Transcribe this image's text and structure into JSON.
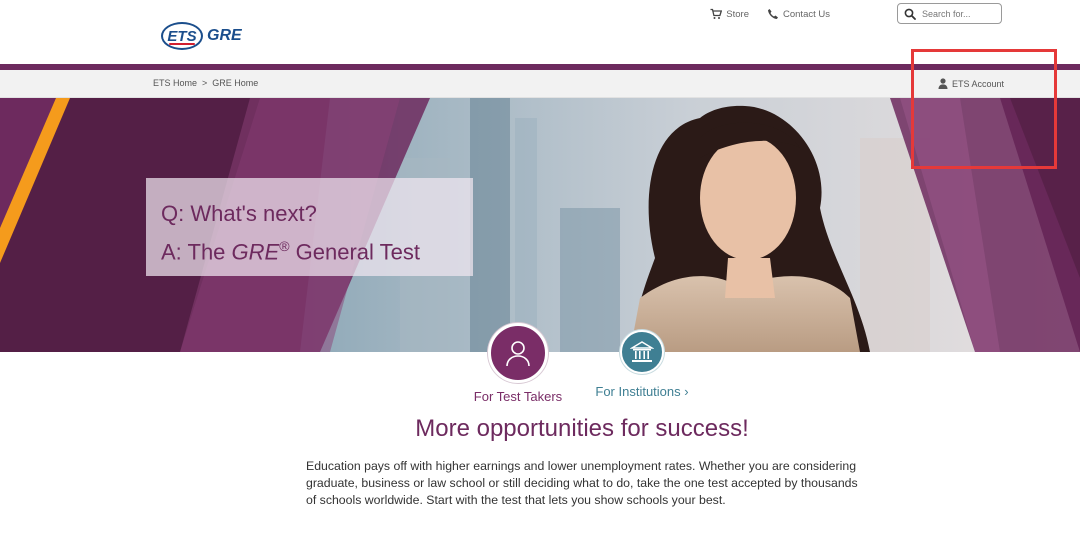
{
  "header": {
    "logo": {
      "ets": "ETS",
      "gre": "GRE"
    },
    "links": {
      "store": "Store",
      "contact": "Contact Us"
    },
    "search": {
      "placeholder": "Search for..."
    }
  },
  "breadcrumb": {
    "items": [
      "ETS Home",
      "GRE Home"
    ],
    "separator": ">"
  },
  "account": {
    "label": "ETS Account"
  },
  "hero": {
    "question": "Q: What's next?",
    "answer_prefix": "A: The ",
    "answer_brand": "GRE",
    "answer_reg": "®",
    "answer_suffix": " General Test"
  },
  "audiences": {
    "takers": "For Test Takers",
    "institutions": "For Institutions ›"
  },
  "section": {
    "title": "More opportunities for success!",
    "body": "Education pays off with higher earnings and lower unemployment rates. Whether you are considering graduate, business or law school or still deciding what to do, take the one test accepted by thousands of schools worldwide. Start with the test that lets you show schools your best."
  },
  "colors": {
    "brand_purple": "#6d2a5e",
    "ets_blue": "#1b4e8c",
    "teal": "#3f7f93",
    "accent_orange": "#f59b1c",
    "highlight_red": "#e53939"
  },
  "icons": [
    "cart-icon",
    "phone-icon",
    "search-icon",
    "user-icon",
    "person-icon",
    "institution-icon"
  ]
}
